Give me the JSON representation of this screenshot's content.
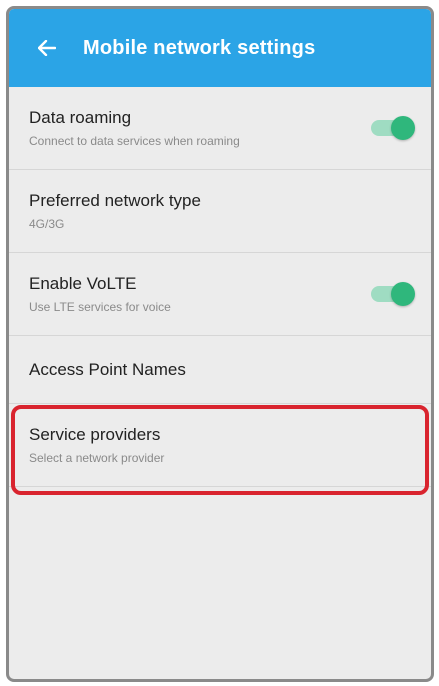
{
  "header": {
    "title": "Mobile network settings",
    "back_icon": "arrow-back-icon"
  },
  "items": [
    {
      "label": "Data roaming",
      "sub": "Connect to data services when roaming",
      "toggle_on": true
    },
    {
      "label": "Preferred network type",
      "sub": "4G/3G"
    },
    {
      "label": "Enable VoLTE",
      "sub": "Use LTE services for voice",
      "toggle_on": true
    },
    {
      "label": "Access Point Names"
    },
    {
      "label": "Service providers",
      "sub": "Select a network provider"
    }
  ],
  "colors": {
    "appbar": "#2ba4e6",
    "toggle_on": "#2fb77c",
    "highlight": "#d9242e"
  }
}
